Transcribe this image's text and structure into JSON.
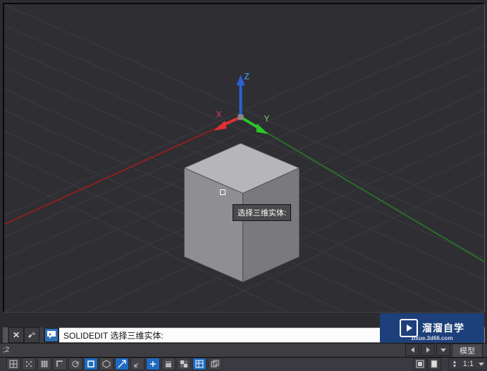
{
  "viewport": {
    "tooltip": "选择三维实体:",
    "axes": {
      "x": "X",
      "y": "Y",
      "z": "Z"
    }
  },
  "command": {
    "text": "SOLIDEDIT 选择三维实体: "
  },
  "model_row": {
    "coord_fragment": ";2",
    "active_tab": "模型"
  },
  "status": {
    "scale_label": "1:1"
  },
  "watermark": {
    "brand": "溜溜自学",
    "url": "zixue.3d66.com"
  },
  "icons": {
    "close": "close-icon",
    "wrench": "wrench-icon",
    "chat": "chat-icon",
    "chev": "chevron-down-icon",
    "snap": "snap-icon",
    "grid": "grid-icon",
    "grid2": "grid-display-icon",
    "ortho": "ortho-icon",
    "polar": "polar-icon",
    "osnap": "osnap-icon",
    "osnap3d": "osnap3d-icon",
    "otrack": "otrack-icon",
    "ducs": "ducs-icon",
    "dyn": "dyn-icon",
    "lwt": "lwt-icon",
    "qp": "qp-icon",
    "sc": "sc-icon",
    "layout_prev": "layout-prev-icon",
    "layout_next": "layout-next-icon",
    "layout_menu": "layout-menu-icon",
    "model_btn": "model-button",
    "paper_btn": "paper-button",
    "ann_scale": "annotation-scale",
    "person": "person-icon"
  }
}
